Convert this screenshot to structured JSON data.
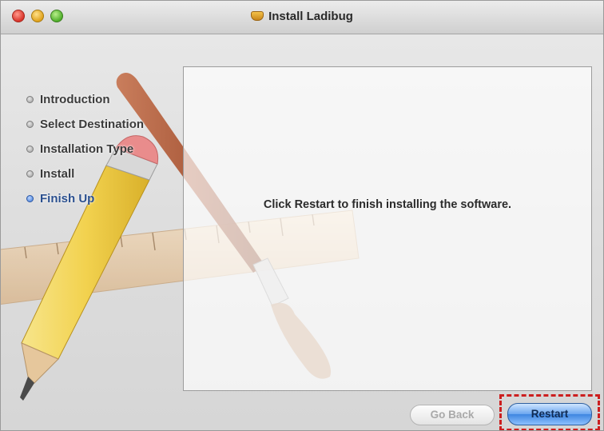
{
  "window": {
    "title": "Install Ladibug"
  },
  "sidebar": {
    "steps": [
      {
        "label": "Introduction",
        "active": false
      },
      {
        "label": "Select Destination",
        "active": false
      },
      {
        "label": "Installation Type",
        "active": false
      },
      {
        "label": "Install",
        "active": false
      },
      {
        "label": "Finish Up",
        "active": true
      }
    ]
  },
  "main": {
    "message": "Click Restart to finish installing the software."
  },
  "footer": {
    "back_label": "Go Back",
    "restart_label": "Restart"
  },
  "colors": {
    "active_step": "#2a4f8e",
    "highlight": "#cc1f1f",
    "primary_button": "#3f86e0"
  }
}
